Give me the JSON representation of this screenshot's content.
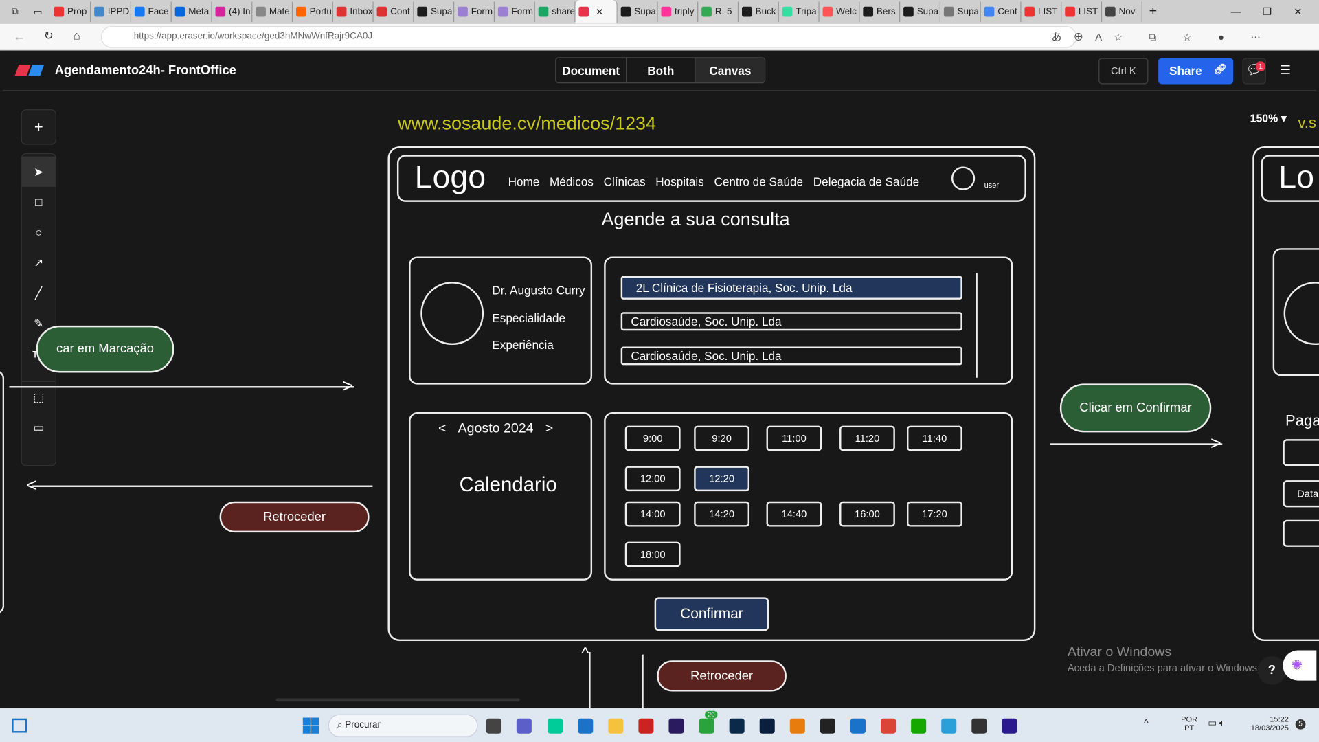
{
  "browser": {
    "tabs": [
      "Prop",
      "IPPD",
      "Face",
      "Meta",
      "(4) In",
      "Mate",
      "Portu",
      "Inbox",
      "Conf",
      "Supa",
      "Form",
      "Form",
      "share",
      "",
      "Supa",
      "triply",
      "R. 5",
      "Buck",
      "Tripa",
      "Welc",
      "Bers",
      "Supa",
      "Supa",
      "Cent",
      "LIST",
      "LIST",
      "Nov"
    ],
    "url": "https://app.eraser.io/workspace/ged3hMNwWnfRajr9CA0J"
  },
  "app": {
    "title": "Agendamento24h- FrontOffice",
    "views": [
      "Document",
      "Both",
      "Canvas"
    ],
    "active_view": "Canvas",
    "search_shortcut": "Ctrl K",
    "share_label": "Share",
    "notifications": "1",
    "zoom": "150%",
    "brand_color": "#2563eb"
  },
  "toolbar": [
    {
      "icon": "plus-icon",
      "key": "/"
    },
    {
      "icon": "pointer-icon",
      "key": "V"
    },
    {
      "icon": "rectangle-icon",
      "key": "R"
    },
    {
      "icon": "circle-icon",
      "key": "O"
    },
    {
      "icon": "arrow-icon",
      "key": "A"
    },
    {
      "icon": "line-icon",
      "key": "L"
    },
    {
      "icon": "pencil-icon",
      "key": "D"
    },
    {
      "icon": "text-icon",
      "key": "T"
    },
    {
      "icon": "frame-icon",
      "key": "F"
    },
    {
      "icon": "comment-icon",
      "key": "C"
    }
  ],
  "canvas": {
    "url_label": "www.sosaude.cv/medicos/1234",
    "logo": "Logo",
    "nav": [
      "Home",
      "Médicos",
      "Clínicas",
      "Hospitais",
      "Centro de Saúde",
      "Delegacia de Saúde"
    ],
    "user": "user",
    "heading": "Agende a sua consulta",
    "doctor": {
      "name": "Dr. Augusto Curry",
      "specialty": "Especialidade",
      "experience": "Experiência"
    },
    "clinics": [
      "2L Clínica de Fisioterapia, Soc. Unip. Lda",
      "Cardiosaúde, Soc. Unip. Lda",
      "Cardiosaúde, Soc. Unip. Lda"
    ],
    "calendar": {
      "prev": "<",
      "month": "Agosto 2024",
      "next": ">",
      "label": "Calendario"
    },
    "slots": [
      "9:00",
      "9:20",
      "11:00",
      "11:20",
      "11:40",
      "12:00",
      "12:20",
      "14:00",
      "14:20",
      "14:40",
      "16:00",
      "17:20",
      "18:00"
    ],
    "selected_slot": "12:20",
    "confirm": "Confirmar",
    "left_action": "car em Marcação",
    "back1": "Retroceder",
    "back2": "Retroceder",
    "right_action": "Clicar em Confirmar",
    "next_logo": "Lo",
    "next_pay": "Paga",
    "next_field": "Data",
    "next_url": "v.s",
    "colors": {
      "selected": "#21365a",
      "green": "#2c5e35",
      "red": "#5a2320",
      "url": "#c8c81e"
    }
  },
  "watermark": {
    "title": "Ativar o Windows",
    "subtitle": "Aceda a Definições para ativar o Windows."
  },
  "help": "?",
  "taskbar": {
    "search": "Procurar",
    "lang1": "POR",
    "lang2": "PT",
    "time": "15:22",
    "date": "18/03/2025",
    "whatsapp_badge": "29",
    "notif": "5"
  }
}
